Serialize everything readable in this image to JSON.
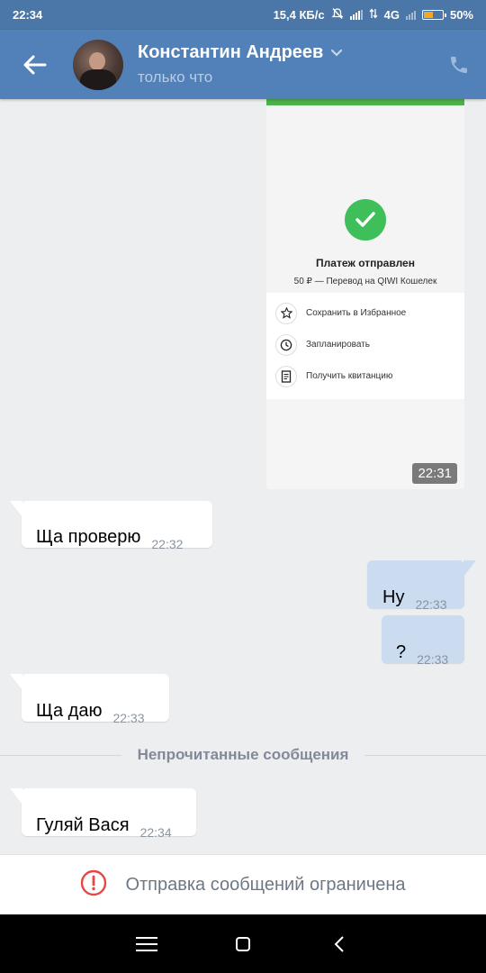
{
  "status_bar": {
    "time": "22:34",
    "network_speed": "15,4 КБ/с",
    "network_type": "4G",
    "battery_percent": "50%",
    "battery_level": 0.5
  },
  "header": {
    "contact_name": "Константин Андреев",
    "status": "только что"
  },
  "photo_message": {
    "payment_title": "Платеж отправлен",
    "payment_subtitle": "50 ₽ — Перевод на QIWI Кошелек",
    "actions": [
      {
        "label": "Сохранить в Избранное",
        "icon": "star-icon"
      },
      {
        "label": "Запланировать",
        "icon": "clock-icon"
      },
      {
        "label": "Получить квитанцию",
        "icon": "receipt-icon"
      }
    ],
    "time": "22:31"
  },
  "messages": [
    {
      "text": "Ща проверю",
      "time": "22:32",
      "direction": "in"
    },
    {
      "text": "Ну",
      "time": "22:33",
      "direction": "out"
    },
    {
      "text": "?",
      "time": "22:33",
      "direction": "out"
    },
    {
      "text": "Ща даю",
      "time": "22:33",
      "direction": "in"
    },
    {
      "text": "Гуляй Вася",
      "time": "22:34",
      "direction": "in"
    }
  ],
  "unread_divider": "Непрочитанные сообщения",
  "restriction": {
    "text": "Отправка сообщений ограничена",
    "icon": "alert-circle-icon",
    "icon_color": "#e64646"
  },
  "colors": {
    "header": "#5181b8",
    "status_bar": "#4a76a8",
    "outgoing_bubble": "#cbdcf1",
    "incoming_bubble": "#ffffff",
    "background": "#edeef0"
  }
}
